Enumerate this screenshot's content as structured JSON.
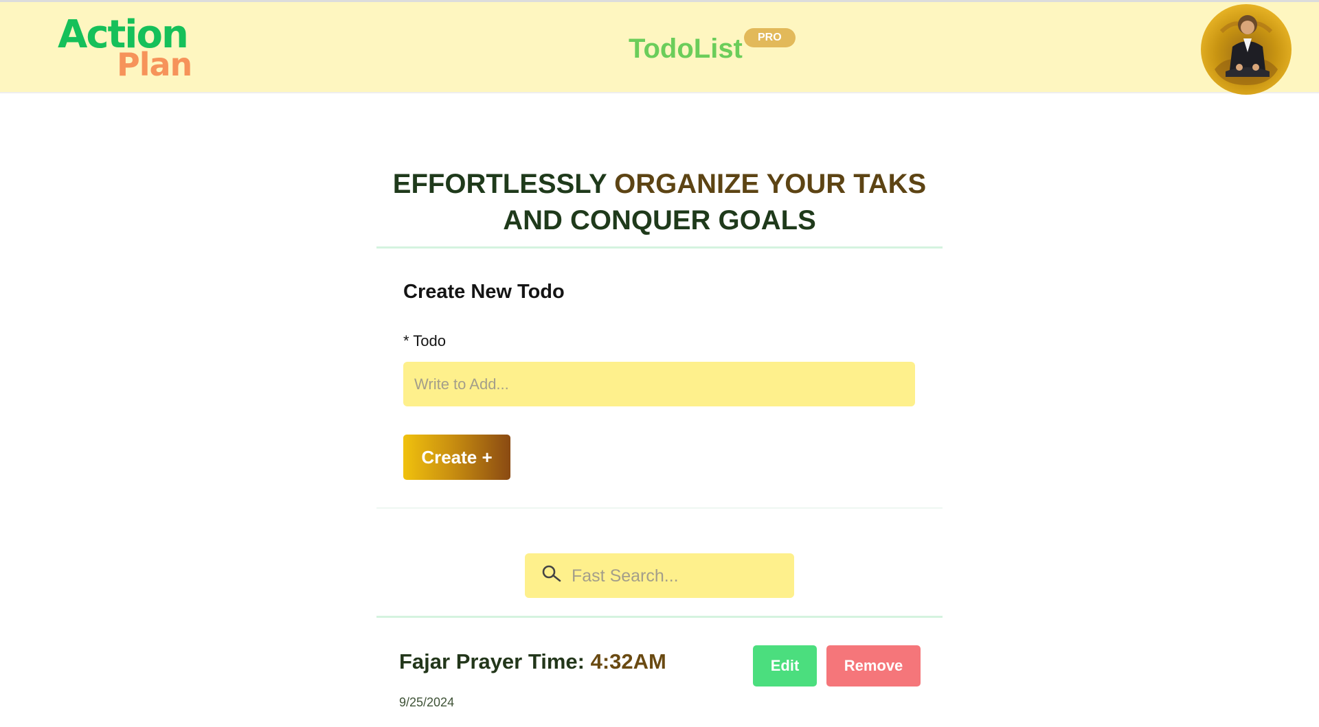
{
  "header": {
    "logo": {
      "line1": "Action",
      "line2": "Plan"
    },
    "app_title": "TodoList",
    "badge": "PRO",
    "avatar_icon": "user-avatar"
  },
  "hero": {
    "part1": "EFFORTLESSLY",
    "part2": "ORGANIZE YOUR TAKS",
    "part3": "AND CONQUER GOALS"
  },
  "form": {
    "title": "Create New Todo",
    "field_label": "* Todo",
    "input_value": "",
    "input_placeholder": "Write to Add...",
    "create_button": "Create +"
  },
  "search": {
    "icon": "search-icon",
    "value": "",
    "placeholder": "Fast Search..."
  },
  "todos": [
    {
      "title_prefix": "Fajar Prayer Time:",
      "title_time": "4:32AM",
      "date": "9/25/2024",
      "edit_label": "Edit",
      "remove_label": "Remove"
    }
  ],
  "colors": {
    "header_bg": "#fef6c0",
    "input_bg": "#fef08c",
    "logo_green": "#16c05a",
    "logo_orange": "#f6935a",
    "edit_green": "#4bde7e",
    "remove_red": "#f5767a"
  }
}
